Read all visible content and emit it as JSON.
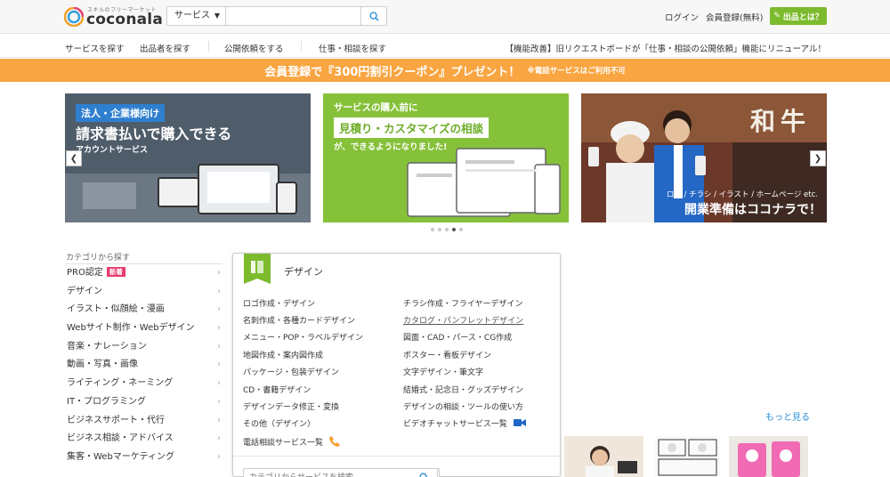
{
  "header": {
    "logo_tagline": "スキルのフリーマーケット",
    "logo_word": "coconala",
    "search_category": "サービス",
    "search_placeholder": "",
    "login": "ログイン",
    "register": "会員登録(無料)",
    "about_button": "出品とは？"
  },
  "nav": {
    "items": [
      "サービスを探す",
      "出品者を探す",
      "公開依頼をする",
      "仕事・相談を探す"
    ],
    "news": "【機能改善】旧リクエストボードが「仕事・相談の公開依頼」機能にリニューアル！"
  },
  "promo": {
    "main": "会員登録で『300円割引クーポン』プレゼント！",
    "note": "※電話サービスはご利用不可"
  },
  "carousel": {
    "slide1": {
      "badge": "法人・企業様向け",
      "title": "請求書払いで購入できる",
      "sub": "アカウントサービス"
    },
    "slide2": {
      "top": "サービスの購入前に",
      "box": "見積り・カスタマイズの相談",
      "bottom": "が、できるようになりました!"
    },
    "slide3": {
      "sub": "ロゴ / チラシ / イラスト / ホームページ etc.",
      "title": "開業準備はココナラで！",
      "sign": "和牛"
    },
    "dots": 5,
    "active_dot": 4
  },
  "categories": {
    "title": "カテゴリから探す",
    "new_badge": "新着",
    "items": [
      "PRO認定",
      "デザイン",
      "イラスト・似顔絵・漫画",
      "Webサイト制作・Webデザイン",
      "音楽・ナレーション",
      "動画・写真・画像",
      "ライティング・ネーミング",
      "IT・プログラミング",
      "ビジネスサポート・代行",
      "ビジネス相談・アドバイス",
      "集客・Webマーケティング"
    ]
  },
  "flyout": {
    "title": "デザイン",
    "left": [
      "ロゴ作成・デザイン",
      "名刺作成・各種カードデザイン",
      "メニュー・POP・ラベルデザイン",
      "地図作成・案内図作成",
      "パッケージ・包装デザイン",
      "CD・書籍デザイン",
      "デザインデータ修正・変換",
      "その他（デザイン）",
      "電話相談サービス一覧"
    ],
    "right": [
      "チラシ作成・フライヤーデザイン",
      "カタログ・パンフレットデザイン",
      "図面・CAD・パース・CG作成",
      "ポスター・看板デザイン",
      "文字デザイン・筆文字",
      "結婚式・記念日・グッズデザイン",
      "デザインの相談・ツールの使い方",
      "ビデオチャットサービス一覧"
    ],
    "search_placeholder": "カテゴリからサービスを検索"
  },
  "more_link": "もっと見る",
  "colors": {
    "brand_green": "#7cbb2e",
    "promo_orange": "#f9a541",
    "link_blue": "#2b8fd6",
    "new_pink": "#e93a6e"
  }
}
